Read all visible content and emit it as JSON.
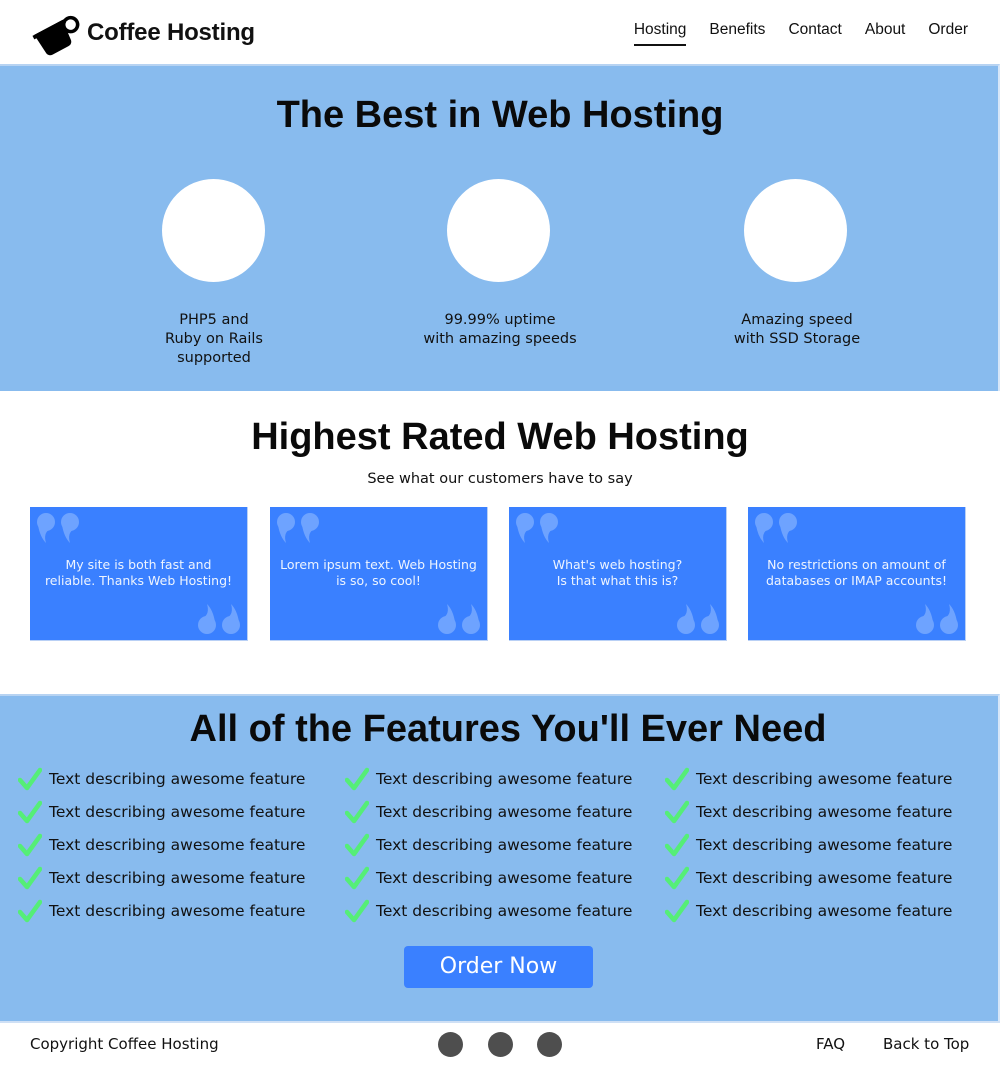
{
  "header": {
    "brand": "Coffee Hosting",
    "logo_icon": "coffee-mug-icon",
    "nav": [
      {
        "label": "Hosting",
        "active": true
      },
      {
        "label": "Benefits",
        "active": false
      },
      {
        "label": "Contact",
        "active": false
      },
      {
        "label": "About",
        "active": false
      },
      {
        "label": "Order",
        "active": false
      }
    ]
  },
  "hero": {
    "title": "The Best in Web Hosting",
    "items": [
      {
        "line1": "PHP5 and",
        "line2": "Ruby on Rails",
        "line3": "supported"
      },
      {
        "line1": "99.99% uptime",
        "line2": "with amazing speeds",
        "line3": ""
      },
      {
        "line1": "Amazing speed",
        "line2": "with SSD Storage",
        "line3": ""
      }
    ]
  },
  "testimonials": {
    "title": "Highest Rated Web Hosting",
    "subtitle": "See what our customers have to say",
    "quote_icon": "quotation-mark-icon",
    "cards": [
      {
        "line1": "My site is both fast and",
        "line2": "reliable. Thanks Web Hosting!"
      },
      {
        "line1": "Lorem ipsum text. Web Hosting",
        "line2": "is so, so cool!"
      },
      {
        "line1": "What's web hosting?",
        "line2": "Is that what this is?"
      },
      {
        "line1": "No restrictions on amount of",
        "line2": "databases or IMAP accounts!"
      }
    ]
  },
  "features": {
    "title": "All of the Features You'll Ever Need",
    "check_icon": "checkmark-icon",
    "columns": [
      [
        "Text describing awesome feature",
        "Text describing awesome feature",
        "Text describing awesome feature",
        "Text describing awesome feature",
        "Text describing awesome feature"
      ],
      [
        "Text describing awesome feature",
        "Text describing awesome feature",
        "Text describing awesome feature",
        "Text describing awesome feature",
        "Text describing awesome feature"
      ],
      [
        "Text describing awesome feature",
        "Text describing awesome feature",
        "Text describing awesome feature",
        "Text describing awesome feature",
        "Text describing awesome feature"
      ]
    ],
    "order_button": "Order Now"
  },
  "footer": {
    "copyright": "Copyright Coffee Hosting",
    "social_icons": [
      "social-icon-1",
      "social-icon-2",
      "social-icon-3"
    ],
    "links": [
      "FAQ",
      "Back to Top"
    ]
  },
  "colors": {
    "section_blue": "#88bbee",
    "card_blue": "#3a80ff",
    "check_green": "#55ee77",
    "social_gray": "#4e4e4e"
  }
}
